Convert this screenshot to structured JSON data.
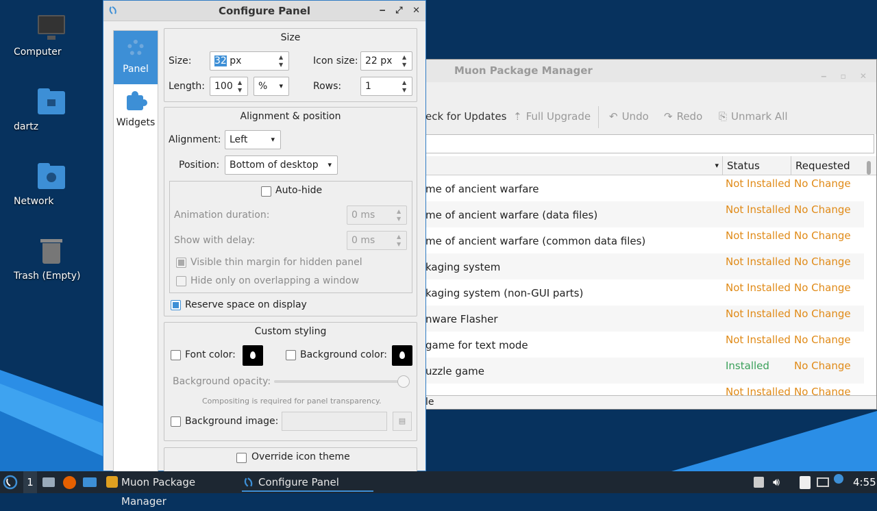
{
  "desktop": {
    "icons": [
      {
        "label": "Computer",
        "icon": "monitor-icon"
      },
      {
        "label": "dartz",
        "icon": "home-folder-icon"
      },
      {
        "label": "Network",
        "icon": "network-folder-icon"
      },
      {
        "label": "Trash (Empty)",
        "icon": "trash-icon"
      }
    ]
  },
  "muon": {
    "title": "Muon Package Manager",
    "toolbar": {
      "check_updates": "eck for Updates",
      "full_upgrade": "Full Upgrade",
      "undo": "Undo",
      "redo": "Redo",
      "unmark_all": "Unmark All"
    },
    "columns": {
      "status": "Status",
      "requested": "Requested"
    },
    "rows": [
      {
        "name": "me of ancient warfare",
        "status": "Not Installed",
        "requested": "No Change"
      },
      {
        "name": "me of ancient warfare (data files)",
        "status": "Not Installed",
        "requested": "No Change"
      },
      {
        "name": "me of ancient warfare (common data files)",
        "status": "Not Installed",
        "requested": "No Change"
      },
      {
        "name": "kaging system",
        "status": "Not Installed",
        "requested": "No Change"
      },
      {
        "name": "kaging system (non-GUI parts)",
        "status": "Not Installed",
        "requested": "No Change"
      },
      {
        "name": "nware Flasher",
        "status": "Not Installed",
        "requested": "No Change"
      },
      {
        "name": "game for text mode",
        "status": "Not Installed",
        "requested": "No Change"
      },
      {
        "name": "uzzle game",
        "status": "Installed",
        "requested": "No Change"
      },
      {
        "name": "",
        "status": "Not Installed",
        "requested": "No Change"
      }
    ],
    "statusbar": "le",
    "colors": {
      "not_installed": "#e08a17",
      "installed": "#3aa05a"
    }
  },
  "cfg": {
    "title": "Configure Panel",
    "sidebar": {
      "panel": "Panel",
      "widgets": "Widgets"
    },
    "size": {
      "title": "Size",
      "size_label": "Size:",
      "size_value": "32",
      "size_unit": "px",
      "icon_size_label": "Icon size:",
      "icon_size_value": "22 px",
      "length_label": "Length:",
      "length_value": "100",
      "length_unit": "%",
      "rows_label": "Rows:",
      "rows_value": "1"
    },
    "align": {
      "title": "Alignment & position",
      "alignment_label": "Alignment:",
      "alignment_value": "Left",
      "position_label": "Position:",
      "position_value": "Bottom of desktop",
      "autohide": "Auto-hide",
      "anim_label": "Animation duration:",
      "anim_value": "0 ms",
      "delay_label": "Show with delay:",
      "delay_value": "0 ms",
      "thin_margin": "Visible thin margin for hidden panel",
      "overlap": "Hide only on overlapping a window",
      "reserve": "Reserve space on display"
    },
    "style": {
      "title": "Custom styling",
      "font_color": "Font color:",
      "bg_color": "Background color:",
      "opacity_label": "Background opacity:",
      "opacity_value": 1.0,
      "compositing_note": "Compositing is required for panel transparency.",
      "bg_image": "Background image:"
    },
    "override": "Override icon theme",
    "accent": "#3d8fd6"
  },
  "taskbar": {
    "workspace": "1",
    "tasks": [
      "Muon Package Manager",
      "Configure Panel"
    ],
    "clock": "4:55"
  }
}
